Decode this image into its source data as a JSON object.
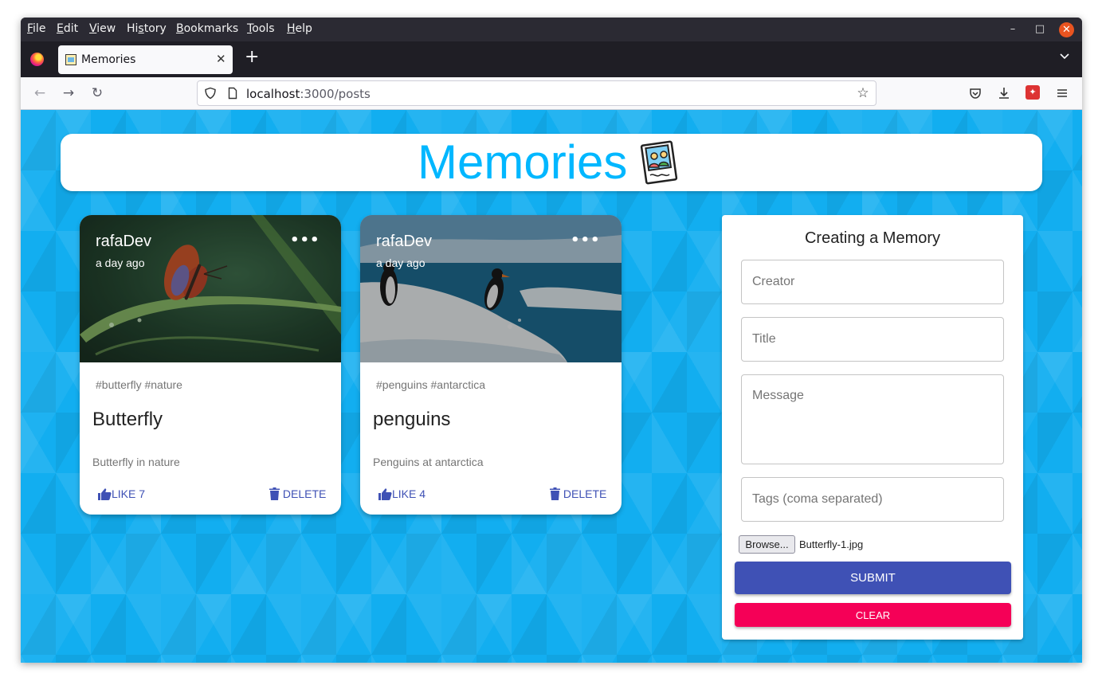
{
  "browser": {
    "menu": [
      "File",
      "Edit",
      "View",
      "History",
      "Bookmarks",
      "Tools",
      "Help"
    ],
    "tab_title": "Memories",
    "url_host": "localhost",
    "url_rest": ":3000/posts",
    "window_controls": [
      "minimize-icon",
      "maximize-icon",
      "close-icon"
    ],
    "toolbar_icons": [
      "pocket-icon",
      "download-icon",
      "extension-icon",
      "hamburger-menu-icon"
    ]
  },
  "app": {
    "title": "Memories",
    "logo_icon": "memories-photo-icon",
    "accent_color": "#00b7ff",
    "background_color": "#12aef0"
  },
  "posts": [
    {
      "creator": "rafaDev",
      "time": "a day ago",
      "tags": "#butterfly #nature",
      "title": "Butterfly",
      "message": "Butterfly in nature",
      "like_label": "LIKE 7",
      "delete_label": "DELETE",
      "image": "butterfly-on-grass"
    },
    {
      "creator": "rafaDev",
      "time": "a day ago",
      "tags": "#penguins #antarctica",
      "title": "penguins",
      "message": "Penguins at antarctica",
      "like_label": "LIKE 4",
      "delete_label": "DELETE",
      "image": "penguins-on-ice"
    }
  ],
  "form": {
    "heading": "Creating a Memory",
    "creator_placeholder": "Creator",
    "title_placeholder": "Title",
    "message_placeholder": "Message",
    "tags_placeholder": "Tags (coma separated)",
    "browse_label": "Browse...",
    "file_name": "Butterfly-1.jpg",
    "submit_label": "SUBMIT",
    "clear_label": "CLEAR",
    "primary_color": "#3f51b5",
    "secondary_color": "#f50057"
  }
}
